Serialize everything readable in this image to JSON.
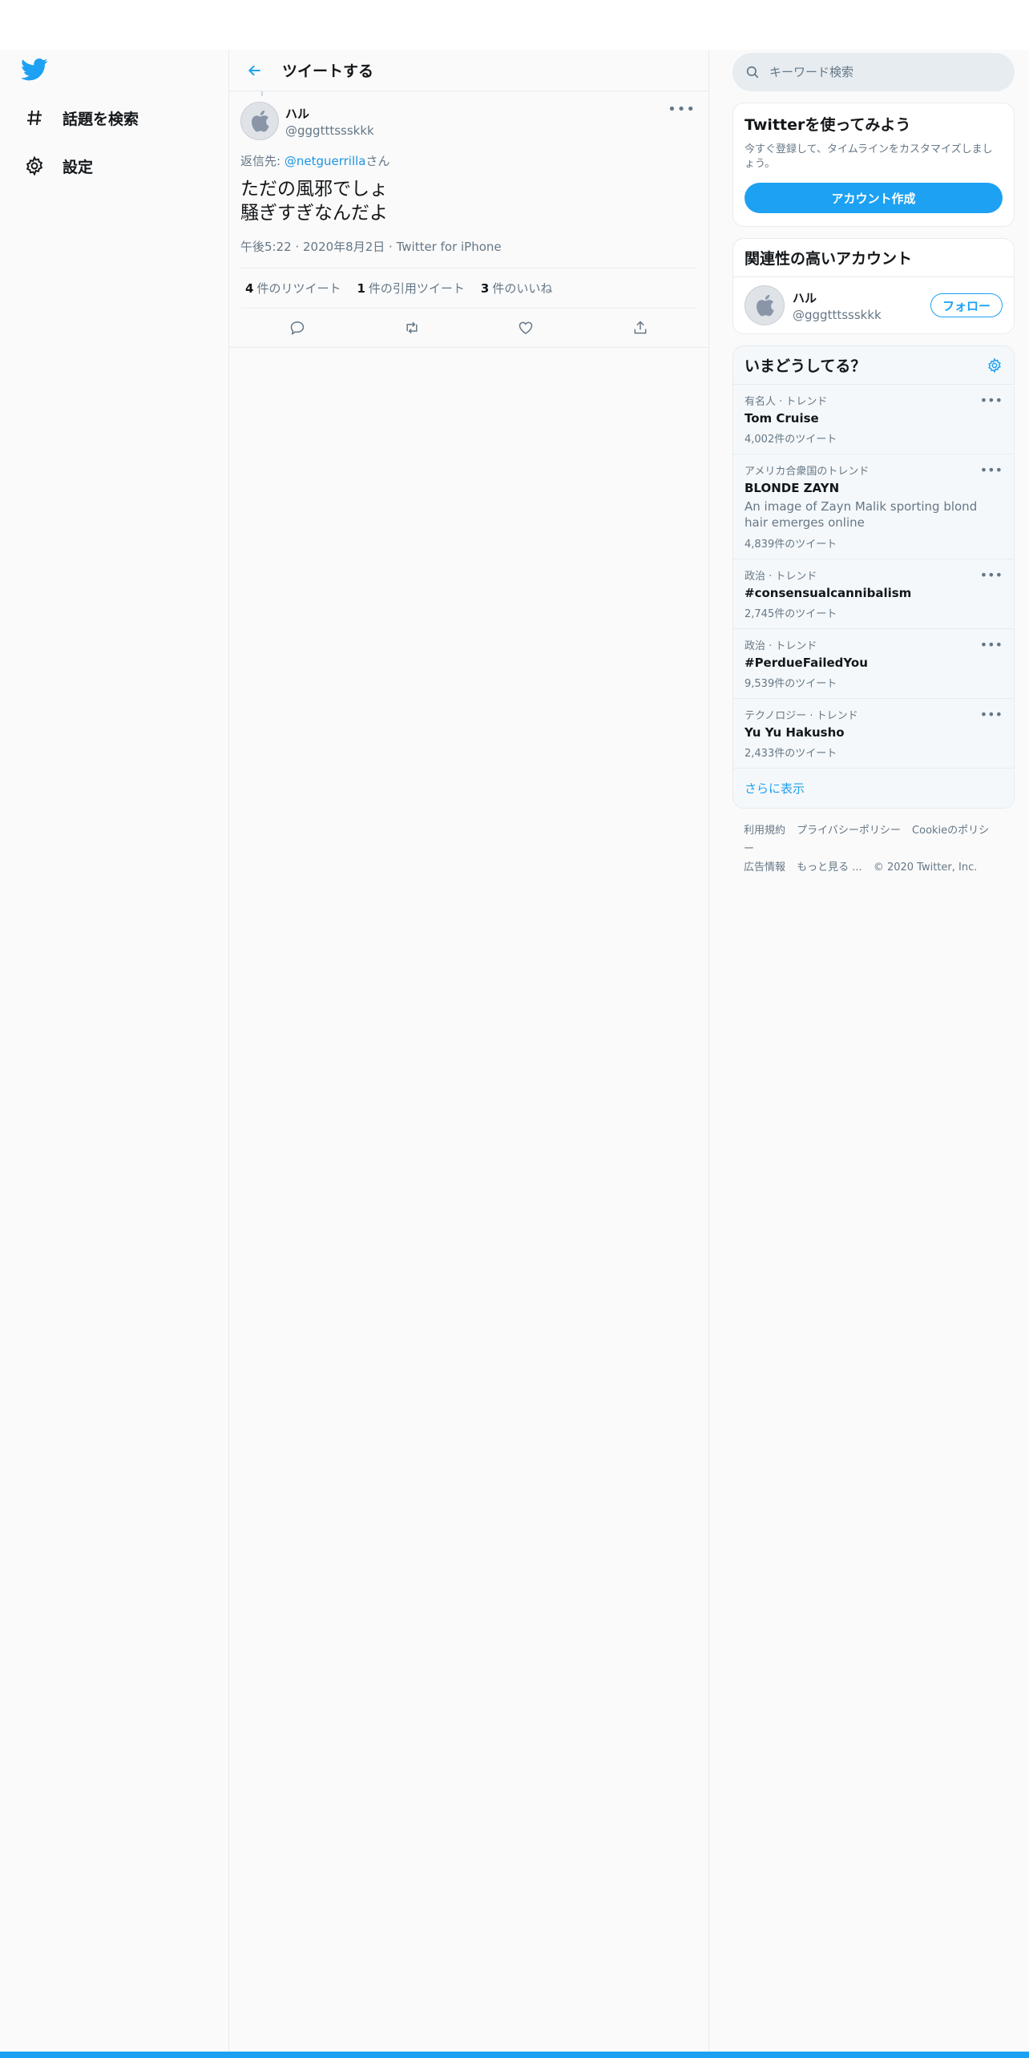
{
  "nav": {
    "items": [
      {
        "label": "話題を検索",
        "icon": "hashtag-icon"
      },
      {
        "label": "設定",
        "icon": "gear-icon"
      }
    ]
  },
  "header": {
    "title": "ツイートする"
  },
  "tweet": {
    "user_name": "ハル",
    "user_handle": "@gggtttssskkk",
    "reply_prefix": "返信先: ",
    "reply_handle": "@netguerrilla",
    "reply_suffix": "さん",
    "body_line1": "ただの風邪でしょ",
    "body_line2": "騒ぎすぎなんだよ",
    "time": "午後5:22",
    "date": "2020年8月2日",
    "source": "Twitter for iPhone",
    "retweets_count": "4",
    "retweets_label": "件のリツイート",
    "quotes_count": "1",
    "quotes_label": "件の引用ツイート",
    "likes_count": "3",
    "likes_label": "件のいいね"
  },
  "search": {
    "placeholder": "キーワード検索"
  },
  "signup": {
    "title": "Twitterを使ってみよう",
    "text": "今すぐ登録して、タイムラインをカスタマイズしましょう。",
    "button": "アカウント作成"
  },
  "related": {
    "title": "関連性の高いアカウント",
    "user_name": "ハル",
    "user_handle": "@gggtttssskkk",
    "follow_label": "フォロー"
  },
  "trends": {
    "title": "いまどうしてる？",
    "items": [
      {
        "context": "有名人 · トレンド",
        "name": "Tom Cruise",
        "desc": "",
        "count": "4,002件のツイート"
      },
      {
        "context": "アメリカ合衆国のトレンド",
        "name": "BLONDE ZAYN",
        "desc": "An image of Zayn Malik sporting blond hair emerges online",
        "count": "4,839件のツイート"
      },
      {
        "context": "政治 · トレンド",
        "name": "#consensualcannibalism",
        "desc": "",
        "count": "2,745件のツイート"
      },
      {
        "context": "政治 · トレンド",
        "name": "#PerdueFailedYou",
        "desc": "",
        "count": "9,539件のツイート"
      },
      {
        "context": "テクノロジー · トレンド",
        "name": "Yu Yu Hakusho",
        "desc": "",
        "count": "2,433件のツイート"
      }
    ],
    "show_more": "さらに表示"
  },
  "footer": {
    "terms": "利用規約",
    "privacy": "プライバシーポリシー",
    "cookie": "Cookieのポリシー",
    "ads": "広告情報",
    "more": "もっと見る ...",
    "copyright": "© 2020 Twitter, Inc."
  },
  "colors": {
    "accent": "#1da1f2",
    "text": "#14171a",
    "muted": "#657786",
    "border": "#e6ecf0"
  }
}
